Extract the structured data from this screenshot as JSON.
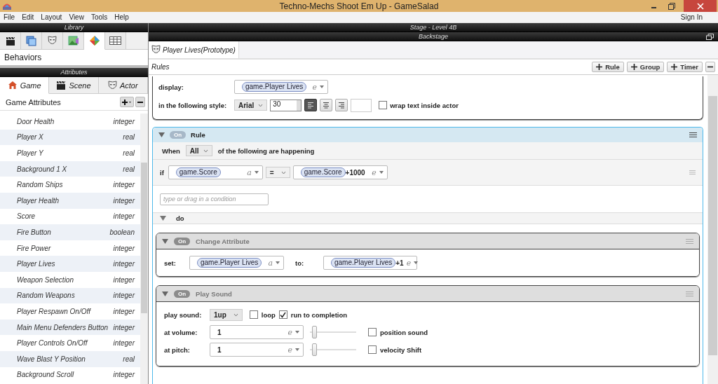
{
  "window": {
    "title": "Techno-Mechs Shoot Em Up - GameSalad"
  },
  "menu": {
    "items": [
      "File",
      "Edit",
      "Layout",
      "View",
      "Tools",
      "Help"
    ],
    "sign_in": "Sign In"
  },
  "library": {
    "title": "Library",
    "tabs": [
      {
        "kind": "clapper",
        "selected": false
      },
      {
        "kind": "squares",
        "selected": false
      },
      {
        "kind": "mask",
        "selected": false
      },
      {
        "kind": "image",
        "selected": false
      },
      {
        "kind": "diamond",
        "selected": true
      },
      {
        "kind": "table",
        "selected": false
      }
    ],
    "section": "Behaviors"
  },
  "attributes": {
    "title": "Attributes",
    "tabs": [
      {
        "label": "Game",
        "kind": "house",
        "selected": true
      },
      {
        "label": "Scene",
        "kind": "clapper",
        "selected": false
      },
      {
        "label": "Actor",
        "kind": "mask",
        "selected": false
      }
    ],
    "heading": "Game Attributes",
    "rows": [
      {
        "name": "Door Health",
        "type": "integer"
      },
      {
        "name": "Player X",
        "type": "real"
      },
      {
        "name": "Player Y",
        "type": "real"
      },
      {
        "name": "Background 1 X",
        "type": "real"
      },
      {
        "name": "Random Ships",
        "type": "integer"
      },
      {
        "name": "Player Health",
        "type": "integer"
      },
      {
        "name": "Score",
        "type": "integer"
      },
      {
        "name": "Fire Button",
        "type": "boolean"
      },
      {
        "name": "Fire Power",
        "type": "integer"
      },
      {
        "name": "Player Lives",
        "type": "integer"
      },
      {
        "name": "Weapon Selection",
        "type": "integer"
      },
      {
        "name": "Random Weapons",
        "type": "integer"
      },
      {
        "name": "Player Respawn On/Off",
        "type": "integer"
      },
      {
        "name": "Main Menu Defenders Button",
        "type": "integer"
      },
      {
        "name": "Player Controls On/Off",
        "type": "integer"
      },
      {
        "name": "Wave Blast Y Position",
        "type": "real"
      },
      {
        "name": "Background Scroll",
        "type": "integer"
      }
    ]
  },
  "stage": {
    "title": "Stage - Level 4B",
    "backstage": "Backstage"
  },
  "editor": {
    "tab": "Player Lives(Prototype)",
    "section": "Rules",
    "buttons": [
      "Rule",
      "Group",
      "Timer"
    ]
  },
  "display": {
    "label": "display:",
    "value": "game.Player Lives",
    "value_icon": "e",
    "style_label": "in the following style:",
    "font": "Arial",
    "size": "30",
    "alignments": [
      {
        "selected": true
      },
      {
        "selected": false
      },
      {
        "selected": false
      }
    ],
    "wrap": {
      "label": "wrap text inside actor",
      "checked": false
    }
  },
  "rule": {
    "toggle": "On",
    "title": "Rule",
    "when": "When",
    "match": "All",
    "match_suffix": "of the following are happening",
    "condition": {
      "keyword": "if",
      "left": "game.Score",
      "left_icon": "a",
      "operator": "=",
      "right": "game.Score",
      "right_expr": "+1000",
      "right_icon": "e"
    },
    "placeholder": "type or drag in a condition",
    "do": "do",
    "behaviors": [
      {
        "kind": "change",
        "toggle": "On",
        "title": "Change Attribute",
        "set_label": "set:",
        "set_value": "game.Player Lives",
        "set_icon": "a",
        "to_label": "to:",
        "to_value": "game.Player Lives",
        "to_expr": "+1",
        "to_icon": "e"
      },
      {
        "kind": "sound",
        "toggle": "On",
        "title": "Play Sound",
        "sound_label": "play sound:",
        "sound": "1up",
        "loop": {
          "label": "loop",
          "checked": false
        },
        "complete": {
          "label": "run to completion",
          "checked": true
        },
        "params": [
          {
            "label": "at volume:",
            "value": "1",
            "icon": "e",
            "level": 0.05,
            "option": {
              "label": "position sound",
              "checked": false
            }
          },
          {
            "label": "at pitch:",
            "value": "1",
            "icon": "e",
            "level": 0.05,
            "option": {
              "label": "velocity Shift",
              "checked": false
            }
          }
        ]
      }
    ]
  }
}
